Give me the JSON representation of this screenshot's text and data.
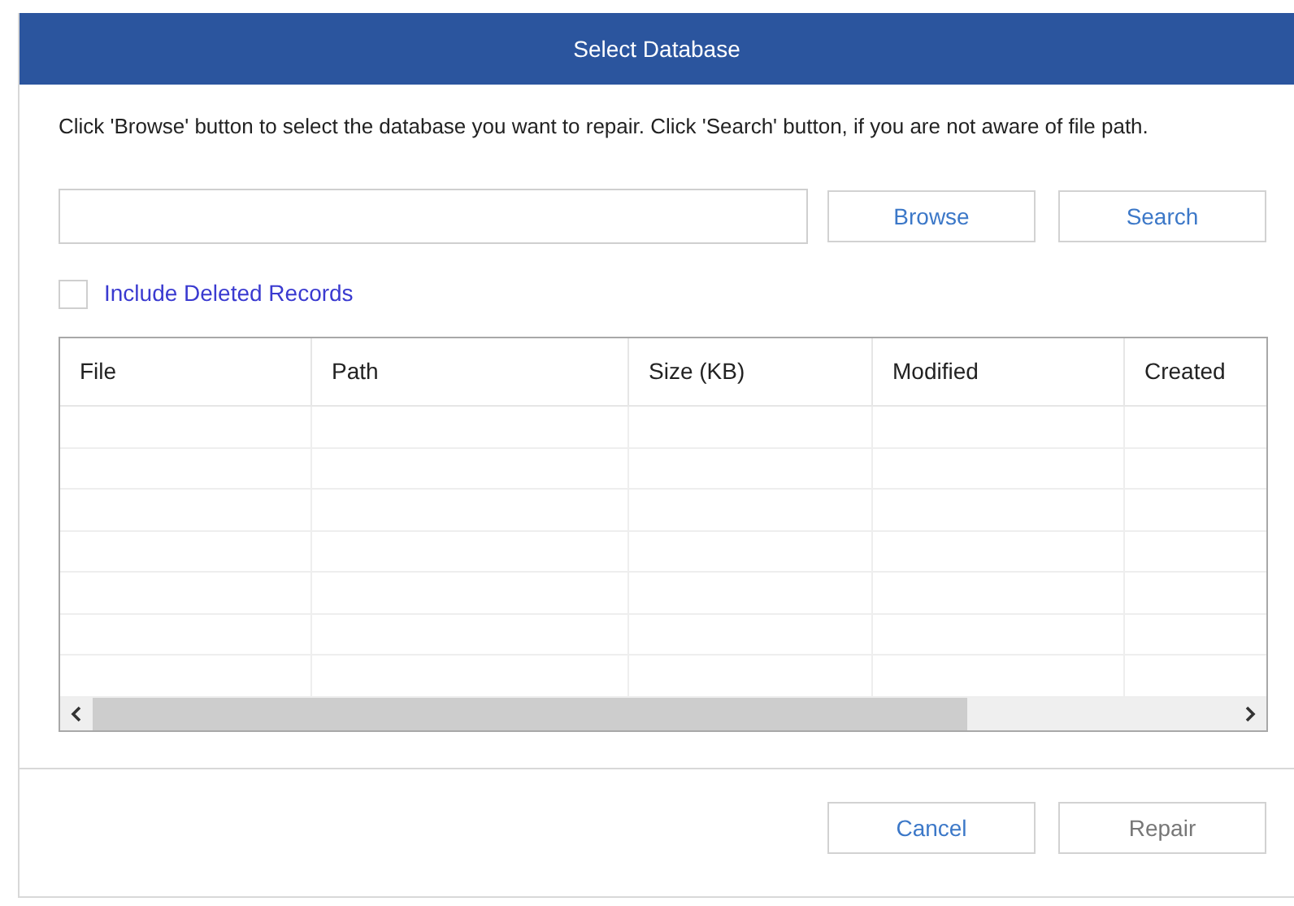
{
  "window": {
    "title": "Select Database"
  },
  "instruction": "Click 'Browse' button to select the database you want to repair. Click 'Search' button, if you are not aware of file path.",
  "buttons": [
    {
      "label": "Browse",
      "disabled": false
    },
    {
      "label": "Search",
      "disabled": false
    }
  ],
  "include_deleted": {
    "label": "Include Deleted Records",
    "checked": false
  },
  "table": {
    "columns": [
      "File",
      "Path",
      "Size (KB)",
      "Modified",
      "Created"
    ]
  },
  "footer_buttons": [
    {
      "label": "Cancel",
      "disabled": false
    },
    {
      "label": "Repair",
      "disabled": true
    }
  ]
}
